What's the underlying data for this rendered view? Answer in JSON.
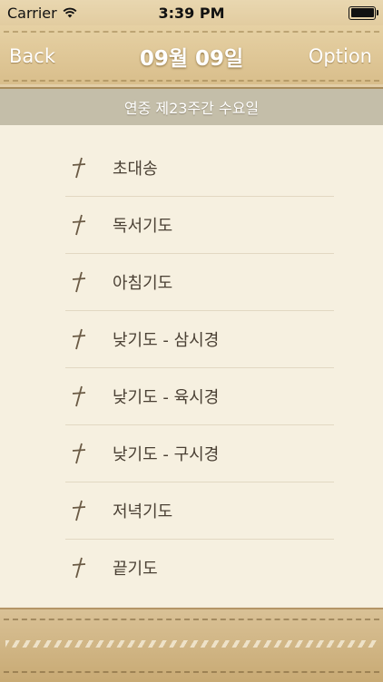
{
  "status_bar": {
    "carrier": "Carrier",
    "time": "3:39 PM",
    "icons": [
      "wifi-icon",
      "battery-icon"
    ]
  },
  "nav": {
    "back_label": "Back",
    "title": "09월 09일",
    "option_label": "Option"
  },
  "subheader": {
    "text": "연중 제23주간 수요일"
  },
  "list": {
    "icon": "cross-icon",
    "items": [
      {
        "label": "초대송"
      },
      {
        "label": "독서기도"
      },
      {
        "label": "아침기도"
      },
      {
        "label": "낮기도 - 삼시경"
      },
      {
        "label": "낮기도 - 육시경"
      },
      {
        "label": "낮기도 - 구시경"
      },
      {
        "label": "저녁기도"
      },
      {
        "label": "끝기도"
      }
    ]
  },
  "colors": {
    "leather": "#dcc393",
    "parchment": "#f6f0e0",
    "subheader": "#c4bea9",
    "text": "#4a4034"
  }
}
